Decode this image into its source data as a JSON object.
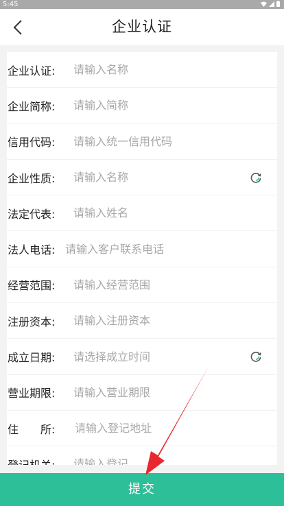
{
  "statusbar": {
    "time": "5:45"
  },
  "header": {
    "title": "企业认证"
  },
  "form": {
    "fields": [
      {
        "label": "企业认证:",
        "placeholder": "请输入名称"
      },
      {
        "label": "企业简称:",
        "placeholder": "请输入简称"
      },
      {
        "label": "信用代码:",
        "placeholder": "请输入统一信用代码"
      },
      {
        "label": "企业性质:",
        "placeholder": "请输入名称"
      },
      {
        "label": "法定代表:",
        "placeholder": "请输入姓名"
      },
      {
        "label": "法人电话:",
        "placeholder": "请输入客户联系电话"
      },
      {
        "label": "经营范围:",
        "placeholder": "请输入经营范围"
      },
      {
        "label": "注册资本:",
        "placeholder": "请输入注册资本"
      },
      {
        "label": "成立日期:",
        "placeholder": "请选择成立时间"
      },
      {
        "label": "营业期限:",
        "placeholder": "请输入营业期限"
      },
      {
        "label": "住　　所:",
        "placeholder": "请输入登记地址"
      },
      {
        "label": "登记机关:",
        "placeholder": "请输入登记"
      }
    ]
  },
  "footer": {
    "submit_label": "提交"
  },
  "colors": {
    "accent": "#2dbf98",
    "annotation_arrow": "#e8282d"
  }
}
